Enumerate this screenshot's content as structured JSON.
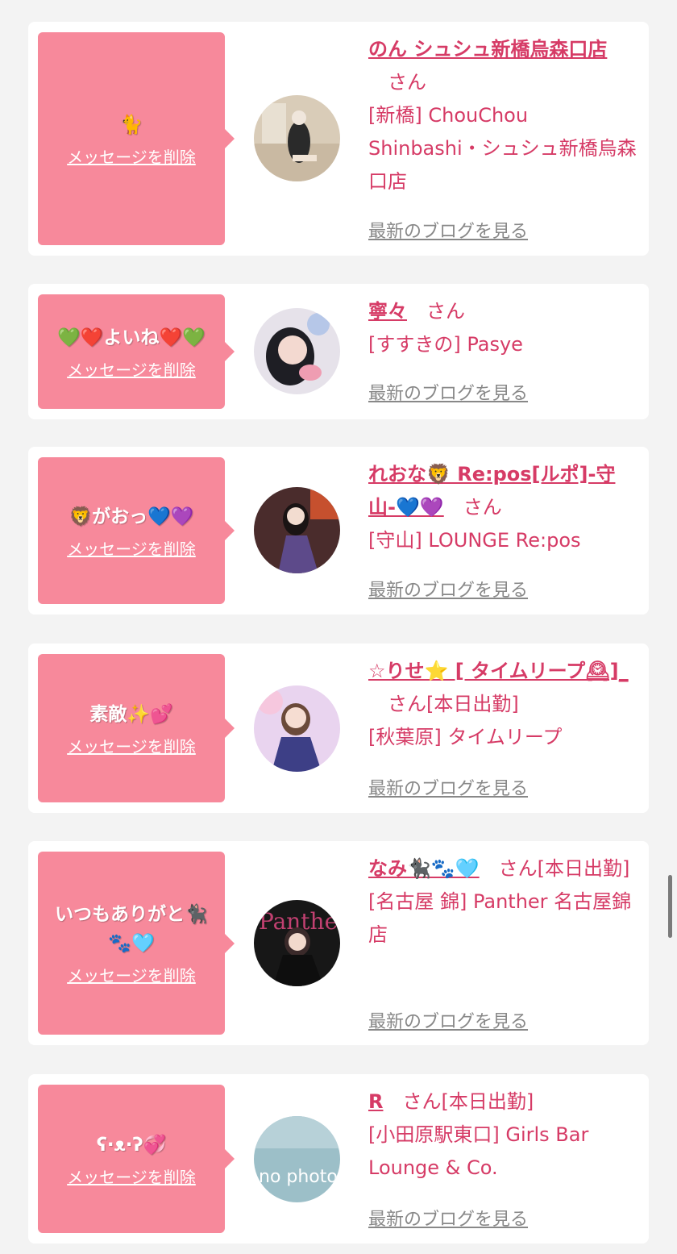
{
  "delete_label": "メッセージを削除",
  "blog_label": "最新のブログを見る",
  "san_label": "さん",
  "cards": [
    {
      "message": "🐈",
      "name": "のん シュシュ新橋烏森口店",
      "status": "",
      "shop": "[新橋] ChouChou Shinbashi・シュシュ新橋烏森口店"
    },
    {
      "message": "💚❤️よいね❤️💚",
      "name": "寧々",
      "status": "",
      "shop": "[すすきの] Pasye"
    },
    {
      "message": "🦁がおっ💙💜",
      "name": "れおな🦁 Re:pos[ルポ]-守山-💙💜",
      "status": "",
      "shop": "[守山] LOUNGE Re:pos"
    },
    {
      "message": "素敵✨💕",
      "name": "☆りせ⭐️ [ タイムリープ🕰]_",
      "status": "[本日出勤]",
      "shop": "[秋葉原] タイムリープ"
    },
    {
      "message": "いつもありがと🐈‍⬛🐾🩵",
      "name": "なみ🐈‍⬛🐾🩵",
      "status": "[本日出勤]",
      "shop": "[名古屋 錦] Panther 名古屋錦店"
    },
    {
      "message": "ʕ·ᴥ·ʔ💞",
      "name": "R",
      "status": "[本日出勤]",
      "shop": "[小田原駅東口] Girls Bar Lounge & Co."
    }
  ],
  "avatar_text": {
    "panther": "Panther",
    "nophoto": "no photo"
  },
  "colors": {
    "accent": "#d63b66",
    "bubble": "#f7899b",
    "background": "#f3f3f3"
  }
}
